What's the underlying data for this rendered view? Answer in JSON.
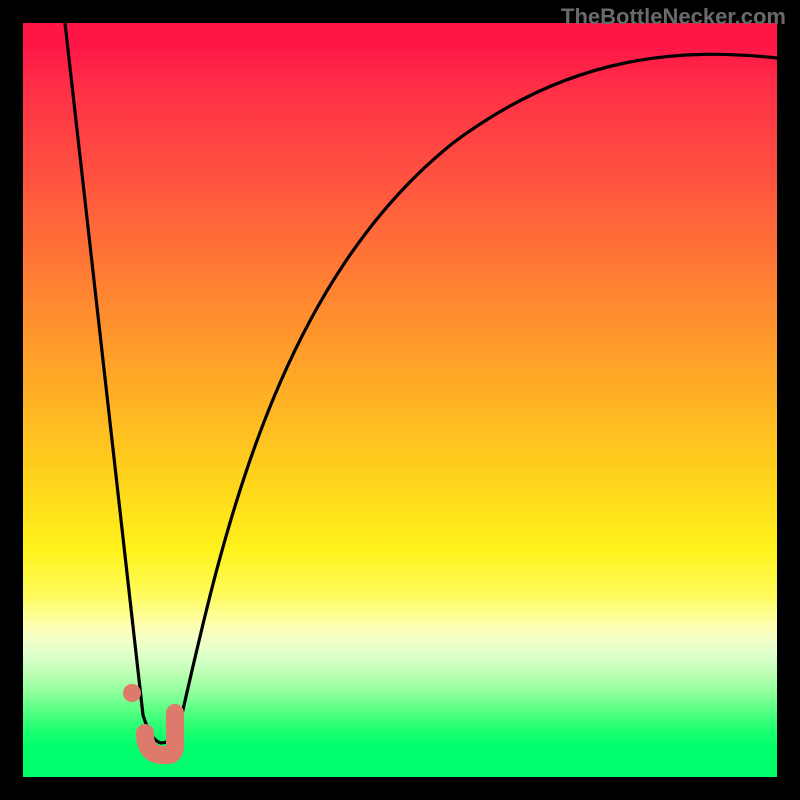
{
  "watermark": "TheBottleNecker.com",
  "chart_data": {
    "type": "line",
    "title": "",
    "xlabel": "",
    "ylabel": "",
    "xlim": [
      0,
      100
    ],
    "ylim": [
      0,
      100
    ],
    "series": [
      {
        "name": "bottleneck-curve",
        "x": [
          5,
          8,
          10,
          12,
          13.5,
          15,
          16,
          17,
          18,
          19,
          20,
          22,
          25,
          30,
          35,
          40,
          45,
          50,
          55,
          60,
          65,
          70,
          75,
          80,
          85,
          90,
          95,
          100
        ],
        "y": [
          100,
          70,
          50,
          30,
          15,
          5,
          1,
          0,
          0.5,
          2,
          5,
          13,
          27,
          45,
          58,
          67,
          73,
          78,
          82,
          85,
          87.5,
          89.5,
          91,
          92.3,
          93.3,
          94.1,
          94.8,
          95.3
        ]
      }
    ],
    "marker": {
      "name": "current-pairing",
      "x": 14.5,
      "y": 8
    },
    "gradient_stops": [
      {
        "pos": 0,
        "color": "#ff1647"
      },
      {
        "pos": 60,
        "color": "#ffd21c"
      },
      {
        "pos": 80,
        "color": "#fdffb4"
      },
      {
        "pos": 100,
        "color": "#00ff6c"
      }
    ]
  }
}
